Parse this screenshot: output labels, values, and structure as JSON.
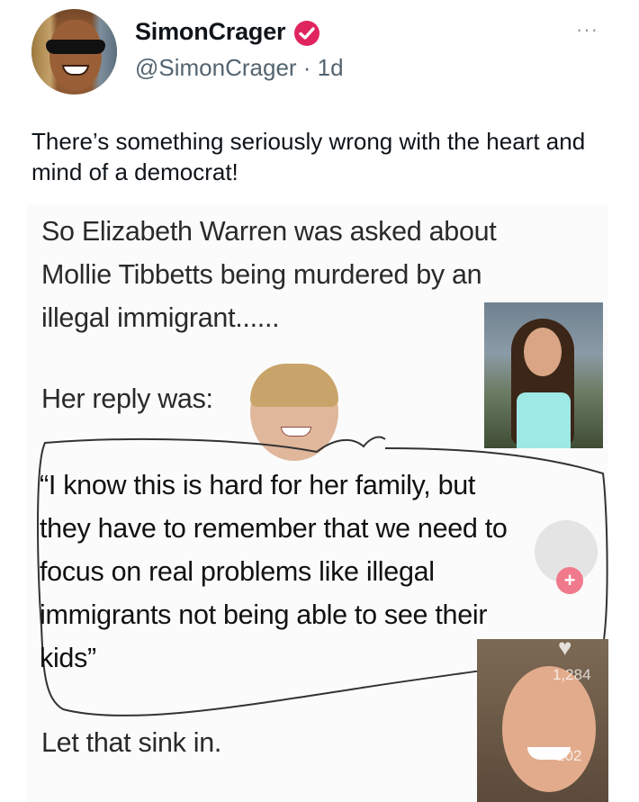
{
  "tweet": {
    "author_name": "SimonCrager",
    "handle": "@SimonCrager",
    "time_ago": "1d",
    "handle_line": "@SimonCrager · 1d",
    "more_label": "···",
    "text": "There’s something seriously wrong with the heart and mind of a democrat!",
    "verified_color": "#e0245e"
  },
  "meme": {
    "lines": [
      "So Elizabeth Warren was asked about",
      "Mollie Tibbetts being murdered by an",
      "illegal immigrant......",
      "Her reply was:"
    ],
    "quote_lines": [
      "“I know this is hard for her family, but",
      "they have to remember that we need to",
      "focus on real problems like illegal",
      "immigrants not being able to see their",
      "kids”"
    ],
    "closing": "Let that sink in.",
    "overlay": {
      "plus": "+",
      "count1": "1,284",
      "count2": "202"
    }
  }
}
